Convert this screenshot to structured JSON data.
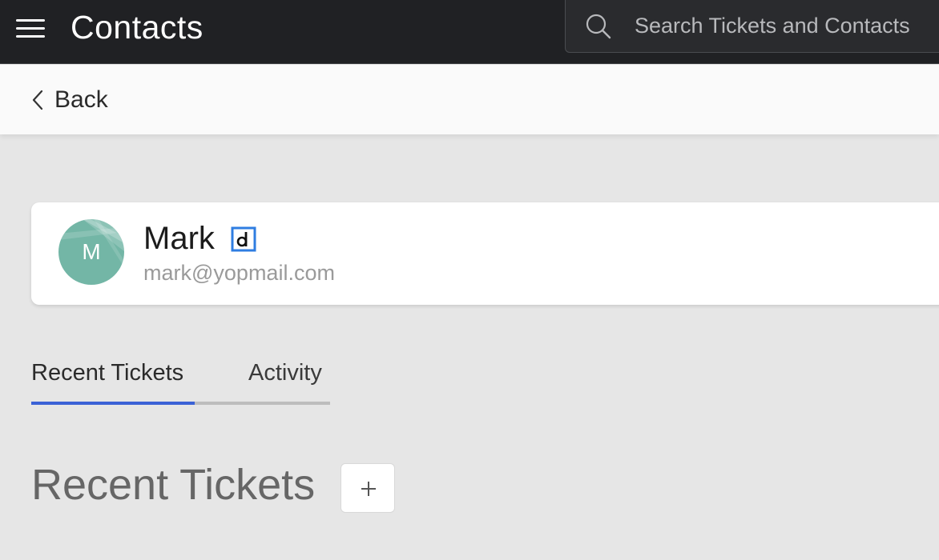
{
  "header": {
    "title": "Contacts",
    "menu_icon": "hamburger-menu-icon",
    "search": {
      "placeholder": "Search Tickets and Contacts",
      "value": "",
      "icon": "search-icon"
    }
  },
  "navigation": {
    "back_label": "Back",
    "back_icon": "chevron-left-icon"
  },
  "contact": {
    "avatar_initial": "M",
    "avatar_color": "#73b6a6",
    "name": "Mark",
    "badge_icon": "desk-source-badge-icon",
    "email": "mark@yopmail.com"
  },
  "tabs": [
    {
      "label": "Recent Tickets",
      "active": true
    },
    {
      "label": "Activity",
      "active": false
    }
  ],
  "section": {
    "title": "Recent Tickets",
    "add_icon": "plus-icon"
  },
  "colors": {
    "topbar": "#202124",
    "accent": "#3b62d6",
    "background": "#e6e6e6"
  }
}
